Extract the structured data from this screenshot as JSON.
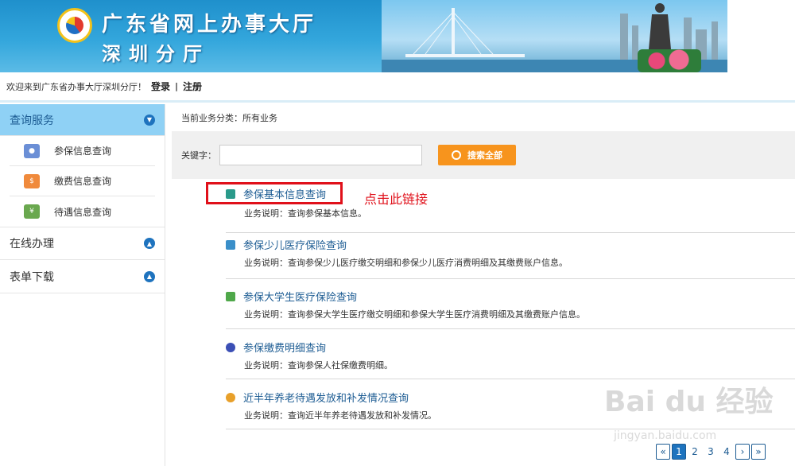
{
  "header": {
    "title_line1": "广东省网上办事大厅",
    "title_line2": "深圳分厅"
  },
  "topbar": {
    "welcome": "欢迎来到广东省办事大厅深圳分厅！",
    "login": "登录",
    "separator": "|",
    "register": "注册"
  },
  "sidebar": {
    "sections": [
      {
        "label": "查询服务",
        "state": "expanded"
      },
      {
        "label": "在线办理",
        "state": "collapsed"
      },
      {
        "label": "表单下载",
        "state": "collapsed"
      }
    ],
    "query_items": [
      {
        "label": "参保信息查询",
        "icon": "person-icon"
      },
      {
        "label": "缴费信息查询",
        "icon": "payment-icon"
      },
      {
        "label": "待遇信息查询",
        "icon": "money-icon"
      }
    ]
  },
  "main": {
    "breadcrumb": "当前业务分类：所有业务",
    "keyword_label": "关键字：",
    "search_value": "",
    "search_button": "搜索全部",
    "services": [
      {
        "name": "参保基本信息查询",
        "desc": "业务说明：查询参保基本信息。"
      },
      {
        "name": "参保少儿医疗保险查询",
        "desc": "业务说明：查询参保少儿医疗缴交明细和参保少儿医疗消费明细及其缴费账户信息。"
      },
      {
        "name": "参保大学生医疗保险查询",
        "desc": "业务说明：查询参保大学生医疗缴交明细和参保大学生医疗消费明细及其缴费账户信息。"
      },
      {
        "name": "参保缴费明细查询",
        "desc": "业务说明：查询参保人社保缴费明细。"
      },
      {
        "name": "近半年养老待遇发放和补发情况查询",
        "desc": "业务说明：查询近半年养老待遇发放和补发情况。"
      }
    ],
    "annotation": "点击此链接"
  },
  "pagination": {
    "first": "«",
    "pages": [
      "1",
      "2",
      "3",
      "4"
    ],
    "current": "1",
    "next": "›",
    "last": "»"
  },
  "watermark": {
    "brand": "Bai du 经验",
    "url": "jingyan.baidu.com"
  },
  "colors": {
    "accent": "#1d5c93",
    "search_button": "#f7941d",
    "highlight": "#e0101a",
    "active_section": "#8fd1f5"
  }
}
